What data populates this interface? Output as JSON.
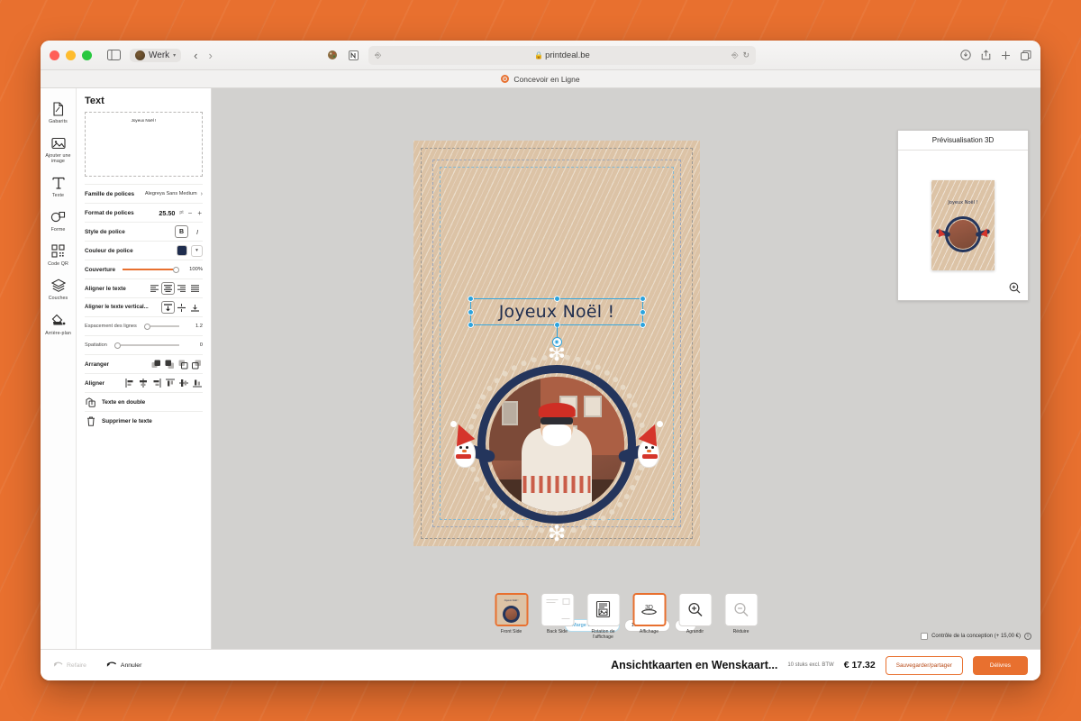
{
  "browser": {
    "werk_label": "Werk",
    "url": "printdeal.be",
    "tab_label": "Concevoir en Ligne",
    "back_icon": "chevron-left-icon",
    "forward_icon": "chevron-right-icon",
    "sidebar_icon": "sidebar-toggle-icon",
    "reader_icon": "reader-icon",
    "reload_icon": "reload-icon",
    "translate_icon": "translate-icon",
    "downloads_icon": "downloads-icon",
    "share_icon": "share-icon",
    "newtab_icon": "plus-icon",
    "tabs_icon": "tab-overview-icon"
  },
  "rail": {
    "items": [
      {
        "label": "Gabarits",
        "icon": "template-icon"
      },
      {
        "label": "Ajouter une image",
        "icon": "image-icon"
      },
      {
        "label": "Texte",
        "icon": "text-icon"
      },
      {
        "label": "Forme",
        "icon": "shape-icon"
      },
      {
        "label": "Code QR",
        "icon": "qr-code-icon"
      },
      {
        "label": "Couches",
        "icon": "layers-icon"
      },
      {
        "label": "Arrière-plan",
        "icon": "background-icon"
      }
    ]
  },
  "properties": {
    "title": "Text",
    "textarea_value": "Joyeux Noël !",
    "font_family_label": "Famille de polices",
    "font_family_value": "Alegreya Sans Medium",
    "font_size_label": "Format de polices",
    "font_size_value": "25.50",
    "font_size_unit": "pt",
    "minus": "−",
    "plus": "+",
    "font_style_label": "Style de police",
    "bold_label": "B",
    "italic_label": "I",
    "font_color_label": "Couleur de police",
    "font_color_value": "#1f2d4e",
    "opacity_label": "Couverture",
    "opacity_value": "100%",
    "align_label": "Aligner le texte",
    "valign_label": "Aligner le texte vertical...",
    "line_spacing_label": "Espacement des lignes",
    "line_spacing_value": "1.2",
    "letter_spacing_label": "Spatiation",
    "letter_spacing_value": "0",
    "arrange_label": "Arranger",
    "align_objects_label": "Aligner",
    "duplicate_label": "Texte en double",
    "delete_label": "Supprimer le texte",
    "align_options": [
      "align-left-icon",
      "align-center-icon",
      "align-right-icon",
      "align-justify-icon"
    ],
    "align_selected": 1,
    "valign_options": [
      "valign-top-icon",
      "valign-middle-icon",
      "valign-bottom-icon"
    ],
    "valign_selected": 0,
    "arrange_icons": [
      "bring-to-front-icon",
      "bring-forward-icon",
      "send-backward-icon",
      "send-to-back-icon"
    ],
    "align_object_icons": [
      "align-obj-left-icon",
      "align-obj-hcenter-icon",
      "align-obj-right-icon",
      "align-obj-top-icon",
      "align-obj-vcenter-icon",
      "align-obj-bottom-icon"
    ],
    "duplicate_icon": "duplicate-icon",
    "delete_icon": "trash-icon",
    "chevron_icon": "chevron-right-icon",
    "color_chevron_icon": "chevron-down-icon"
  },
  "canvas": {
    "card_text": "Joyeux Noël !",
    "chips": [
      {
        "label": "Marge de sécurité",
        "type": "safe"
      },
      {
        "label": "105 x 148 mm",
        "type": "plain"
      },
      {
        "label": "Fin",
        "type": "plain"
      }
    ],
    "rotate_handle_icon": "rotate-icon"
  },
  "preview": {
    "title": "Prévisualisation 3D",
    "card_text": "Joyeux Noël !",
    "zoom_icon": "zoom-in-icon"
  },
  "view_bar": {
    "items": [
      {
        "label": "Front Side",
        "selected": true,
        "icon": "front-side-thumb"
      },
      {
        "label": "Back Side",
        "selected": false,
        "icon": "back-side-thumb"
      },
      {
        "label": "Rotation de l'affichage",
        "selected": false,
        "icon": "rotate-view-icon"
      },
      {
        "label": "Affichage",
        "selected": true,
        "icon": "three-d-icon"
      },
      {
        "label": "Agrandir",
        "selected": false,
        "icon": "zoom-in-icon"
      },
      {
        "label": "Réduire",
        "selected": false,
        "icon": "zoom-out-icon"
      }
    ],
    "design_check_label": "Contrôle de la conception (+ 15,00 €)",
    "design_check_checked": false,
    "info_icon": "info-icon"
  },
  "bottom_bar": {
    "redo_label": "Refaire",
    "redo_icon": "redo-icon",
    "undo_label": "Annuler",
    "undo_icon": "undo-icon",
    "product_title": "Ansichtkaarten en Wenskaart...",
    "quantity_note": "10 stuks excl. BTW",
    "price": "€ 17.32",
    "save_share_label": "Sauvegarder/partager",
    "deliver_label": "Délivres"
  },
  "colors": {
    "accent": "#e8702f",
    "backdrop": "#e8702f",
    "card": "#dcc3a6",
    "navy": "#24355c",
    "selection": "#2ba3de"
  }
}
